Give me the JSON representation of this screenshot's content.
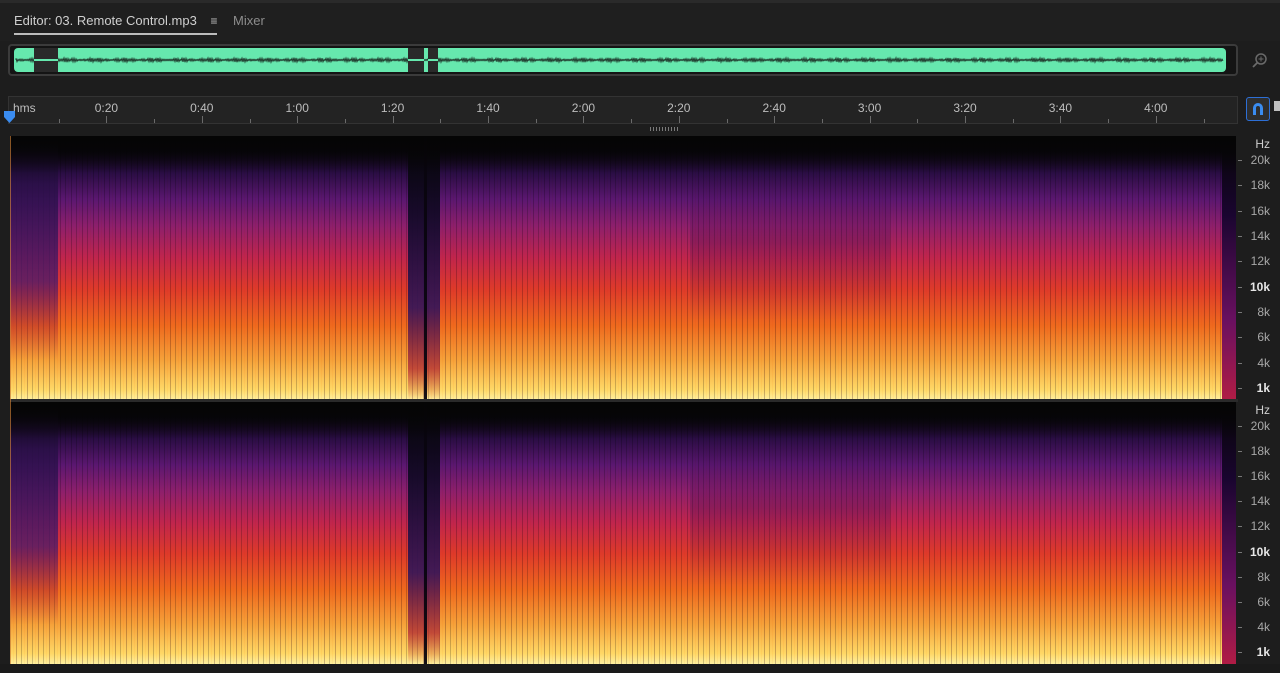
{
  "tabs": {
    "editor_label": "Editor: 03. Remote Control.mp3",
    "editor_menu_icon": "≡",
    "mixer_label": "Mixer"
  },
  "overview": {
    "waveform_color": "#66e8ae"
  },
  "ruler": {
    "unit_label": "hms",
    "ticks": [
      "0:20",
      "0:40",
      "1:00",
      "1:20",
      "1:40",
      "2:00",
      "2:20",
      "2:40",
      "3:00",
      "3:20",
      "3:40",
      "4:00"
    ]
  },
  "frequency_axis": {
    "unit_label": "Hz",
    "labels": [
      "20k",
      "18k",
      "16k",
      "14k",
      "12k",
      "10k",
      "8k",
      "6k",
      "4k",
      "1k"
    ],
    "bold_labels": [
      "10k",
      "1k"
    ]
  },
  "icons": {
    "zoom_navigator": "zoom-navigator-icon",
    "snap": "magnet-snap-icon",
    "playhead": "playhead-marker-icon"
  },
  "colors": {
    "accent": "#2d6fd6",
    "spectrogram_low": "#ffd866",
    "spectrogram_mid": "#de3a2a",
    "spectrogram_high": "#5b1770"
  }
}
